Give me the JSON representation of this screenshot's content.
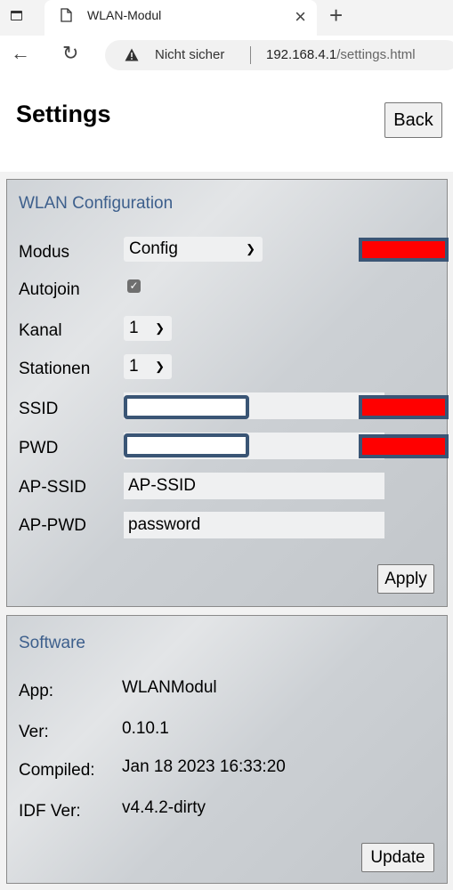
{
  "browser": {
    "tab_title": "WLAN-Modul",
    "tab_close": "×",
    "new_tab": "+",
    "back_glyph": "←",
    "reload_glyph": "↻",
    "security_label": "Nicht sicher",
    "url_host": "192.168.4.1",
    "url_path": "/settings.html",
    "icons": [
      "window-icon",
      "page-icon",
      "warning-icon"
    ]
  },
  "page": {
    "title": "Settings",
    "back_label": "Back"
  },
  "wlan": {
    "legend": "WLAN Configuration",
    "modus_label": "Modus",
    "modus_value": "Config",
    "autojoin_label": "Autojoin",
    "autojoin_checked": true,
    "kanal_label": "Kanal",
    "kanal_value": "1",
    "stationen_label": "Stationen",
    "stationen_value": "1",
    "ssid_label": "SSID",
    "ssid_value": "",
    "pwd_label": "PWD",
    "pwd_value": "",
    "ap_ssid_label": "AP-SSID",
    "ap_ssid_value": "AP-SSID",
    "ap_pwd_label": "AP-PWD",
    "ap_pwd_value": "password",
    "apply_label": "Apply",
    "redaction_color": "#ff0000",
    "field_border_color": "#3a5575"
  },
  "software": {
    "legend": "Software",
    "app_label": "App:",
    "app_value": "WLANModul",
    "ver_label": "Ver:",
    "ver_value": "0.10.1",
    "compiled_label": "Compiled:",
    "compiled_value": "Jan 18 2023 16:33:20",
    "idf_label": "IDF Ver:",
    "idf_value": "v4.4.2-dirty",
    "update_label": "Update"
  },
  "colors": {
    "legend_text": "#3d5f8c",
    "panel_border": "#8a8a8a"
  }
}
